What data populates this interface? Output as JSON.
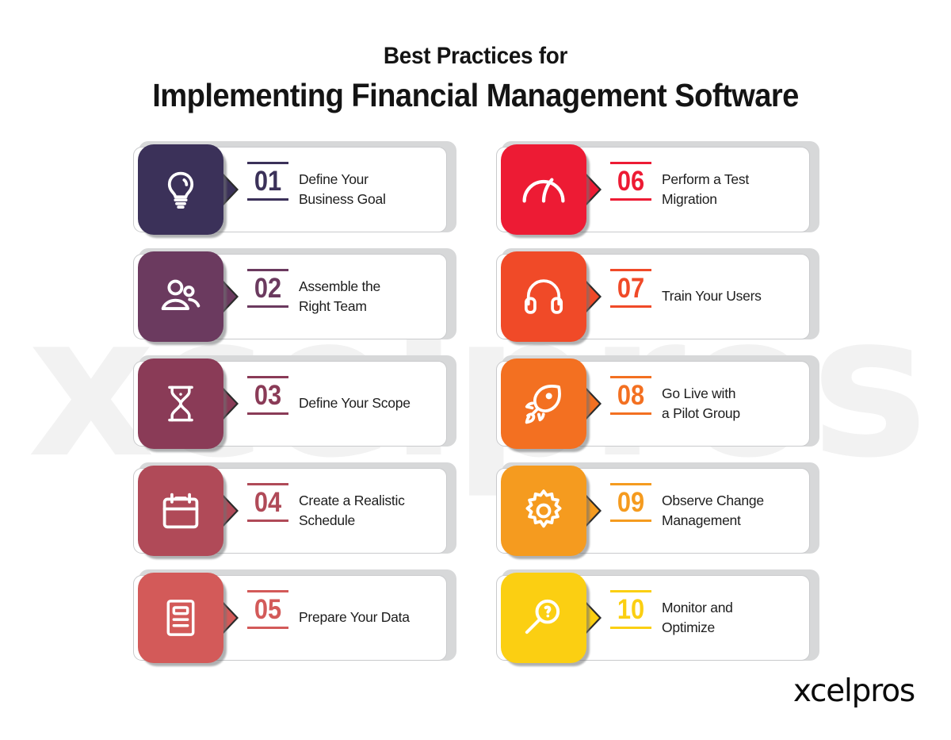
{
  "header": {
    "eyebrow": "Best Practices for",
    "title": "Implementing Financial Management Software"
  },
  "watermark": {
    "text": "xcelpros"
  },
  "brand": {
    "logo_text": "xcelpros"
  },
  "colors": {
    "background": "#ffffff",
    "card_backing": "#d7d8d9",
    "card_border": "#c9cacc",
    "title_text": "#141414",
    "label_text": "#1d1d1d",
    "watermark": "#f2f2f2"
  },
  "cards": [
    {
      "number": "01",
      "label": "Define Your\nBusiness Goal",
      "icon": "lightbulb-icon",
      "color": "#3b3159",
      "column": "left"
    },
    {
      "number": "02",
      "label": "Assemble the\nRight Team",
      "icon": "team-people-icon",
      "color": "#6b3a5f",
      "column": "left"
    },
    {
      "number": "03",
      "label": "Define Your Scope",
      "icon": "hourglass-icon",
      "color": "#8a3b57",
      "column": "left"
    },
    {
      "number": "04",
      "label": "Create a Realistic\nSchedule",
      "icon": "calendar-icon",
      "color": "#b04a58",
      "column": "left"
    },
    {
      "number": "05",
      "label": "Prepare Your Data",
      "icon": "document-data-icon",
      "color": "#d35a59",
      "column": "left"
    },
    {
      "number": "06",
      "label": "Perform a Test\nMigration",
      "icon": "speedometer-icon",
      "color": "#ed1b34",
      "column": "right"
    },
    {
      "number": "07",
      "label": "Train Your Users",
      "icon": "headphones-icon",
      "color": "#f04a28",
      "column": "right"
    },
    {
      "number": "08",
      "label": "Go Live with\na Pilot Group",
      "icon": "rocket-icon",
      "color": "#f37021",
      "column": "right"
    },
    {
      "number": "09",
      "label": "Observe Change\nManagement",
      "icon": "gear-icon",
      "color": "#f59b1f",
      "column": "right"
    },
    {
      "number": "10",
      "label": "Monitor and\nOptimize",
      "icon": "magnifier-icon",
      "color": "#fbcf12",
      "column": "right"
    }
  ]
}
